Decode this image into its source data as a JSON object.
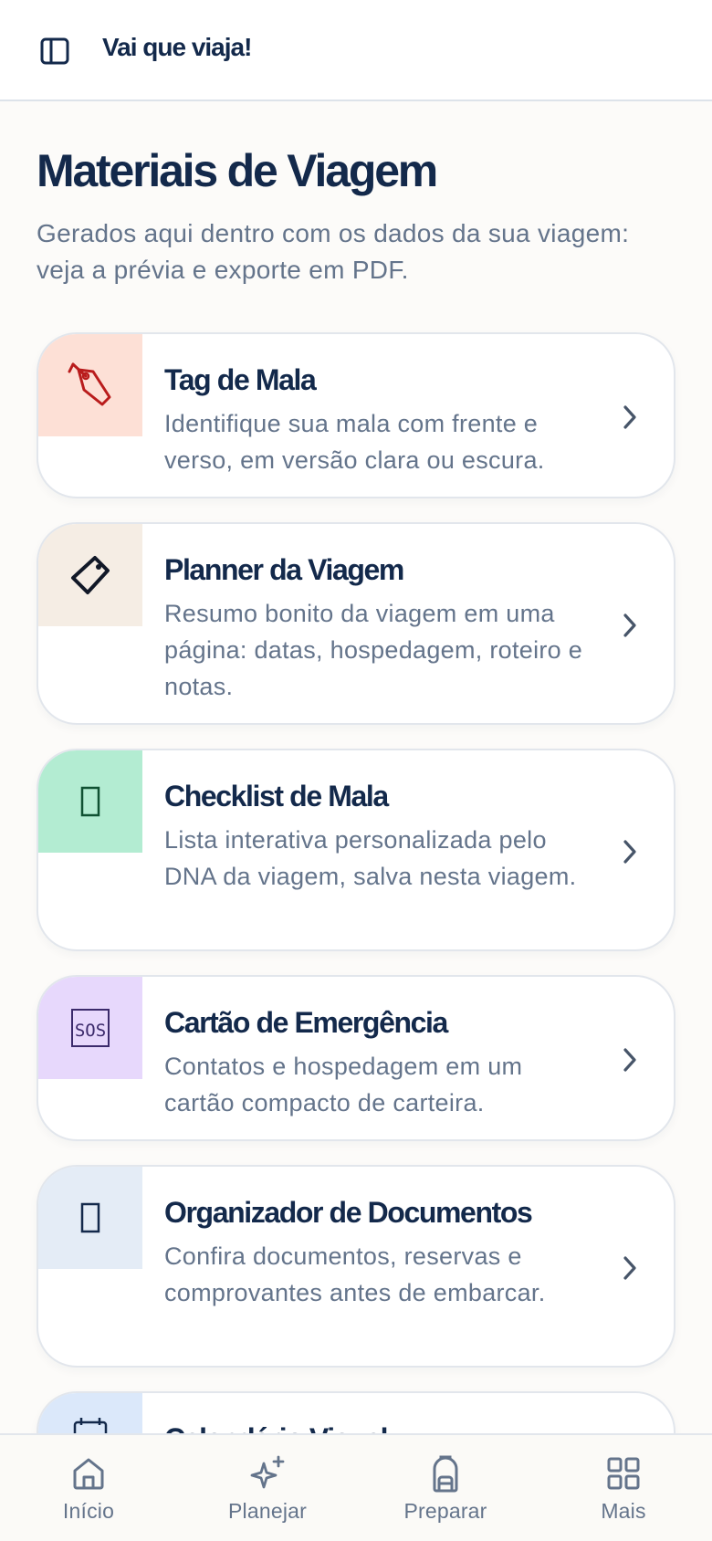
{
  "app": {
    "title": "Vai que viaja!"
  },
  "page": {
    "title": "Materiais de Viagem",
    "subtitle": "Gerados aqui dentro com os dados da sua viagem: veja a prévia e exporte em PDF."
  },
  "cards": [
    {
      "title": "Tag de Mala",
      "description": "Identifique sua mala com frente e verso, em versão clara ou escura.",
      "icon": "luggage-tag-icon",
      "icon_bg": "#fde0d6",
      "icon_color": "#b91c1c"
    },
    {
      "title": "Planner da Viagem",
      "description": "Resumo bonito da viagem em uma página: datas, hospedagem, roteiro e notas.",
      "icon": "tag-icon",
      "icon_bg": "#f5ede4",
      "icon_color": "#111827"
    },
    {
      "title": "Checklist de Mala",
      "description": "Lista interativa personalizada pelo DNA da viagem, salva nesta viagem.",
      "icon": "checklist-icon",
      "icon_bg": "#b3ecd2",
      "icon_color": "#0f5132"
    },
    {
      "title": "Cartão de Emergência",
      "description": "Contatos e hospedagem em um cartão compacto de carteira.",
      "icon": "sos-icon",
      "icon_glyph": "🆘",
      "icon_bg": "#e7d8fc",
      "icon_color": "#3b2a6b"
    },
    {
      "title": "Organizador de Documentos",
      "description": "Confira documentos, reservas e comprovantes antes de embarcar.",
      "icon": "documents-icon",
      "icon_bg": "#e4ecf6",
      "icon_color": "#13294b"
    },
    {
      "title": "Calendário Visual",
      "description": "",
      "icon": "calendar-icon",
      "icon_bg": "#dbe8fa",
      "icon_color": "#13294b"
    }
  ],
  "bottom_nav": [
    {
      "label": "Início",
      "icon": "home-icon"
    },
    {
      "label": "Planejar",
      "icon": "sparkles-icon"
    },
    {
      "label": "Preparar",
      "icon": "backpack-icon"
    },
    {
      "label": "Mais",
      "icon": "grid-icon"
    }
  ]
}
